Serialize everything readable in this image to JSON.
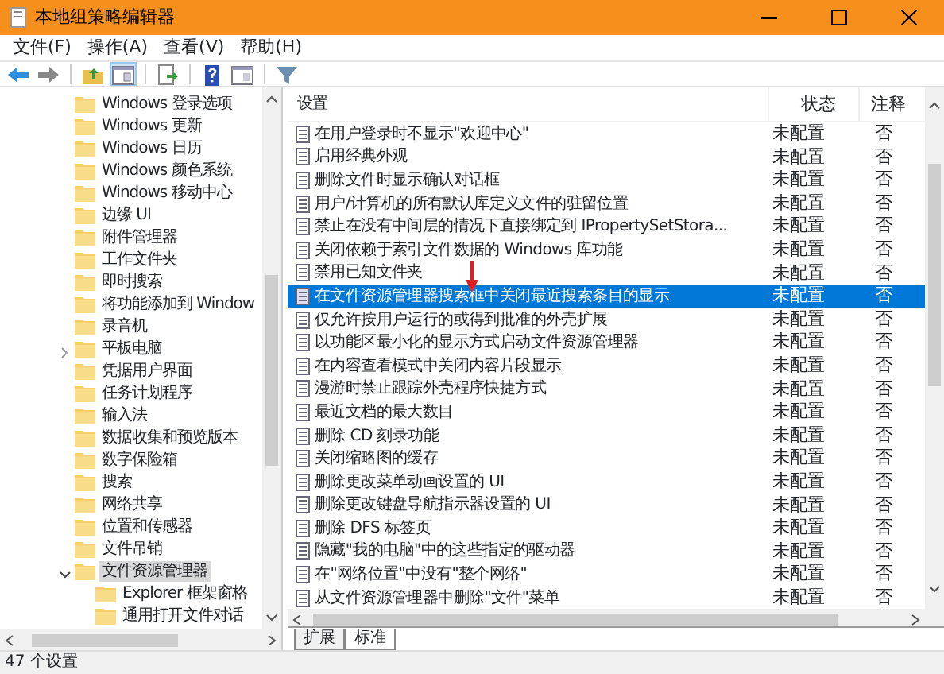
{
  "window": {
    "title": "本地组策略编辑器"
  },
  "menu": [
    "文件(F)",
    "操作(A)",
    "查看(V)",
    "帮助(H)"
  ],
  "toolbar": [
    {
      "kind": "back",
      "disabled": false
    },
    {
      "kind": "forward",
      "disabled": true
    },
    {
      "kind": "sep"
    },
    {
      "kind": "up"
    },
    {
      "kind": "tree",
      "pressed": true
    },
    {
      "kind": "sep"
    },
    {
      "kind": "export"
    },
    {
      "kind": "sep"
    },
    {
      "kind": "help"
    },
    {
      "kind": "view"
    },
    {
      "kind": "sep"
    },
    {
      "kind": "filter"
    }
  ],
  "tree": [
    {
      "label": "Windows 登录选项",
      "selected": false
    },
    {
      "label": "Windows 更新",
      "selected": false
    },
    {
      "label": "Windows 日历",
      "selected": false
    },
    {
      "label": "Windows 颜色系统",
      "selected": false
    },
    {
      "label": "Windows 移动中心",
      "selected": false
    },
    {
      "label": "边缘 UI",
      "selected": false
    },
    {
      "label": "附件管理器",
      "selected": false
    },
    {
      "label": "工作文件夹",
      "selected": false
    },
    {
      "label": "即时搜索",
      "selected": false
    },
    {
      "label": "将功能添加到 Window",
      "selected": false
    },
    {
      "label": "录音机",
      "selected": false
    },
    {
      "label": "平板电脑",
      "selected": false,
      "expanded": false
    },
    {
      "label": "凭据用户界面",
      "selected": false
    },
    {
      "label": "任务计划程序",
      "selected": false
    },
    {
      "label": "输入法",
      "selected": false
    },
    {
      "label": "数据收集和预览版本",
      "selected": false
    },
    {
      "label": "数字保险箱",
      "selected": false
    },
    {
      "label": "搜索",
      "selected": false
    },
    {
      "label": "网络共享",
      "selected": false
    },
    {
      "label": "位置和传感器",
      "selected": false
    },
    {
      "label": "文件吊销",
      "selected": false
    },
    {
      "label": "文件资源管理器",
      "selected": true,
      "expanded": true,
      "children": [
        {
          "label": "Explorer 框架窗格",
          "selected": false
        },
        {
          "label": "通用打开文件对话",
          "selected": false
        }
      ]
    }
  ],
  "table": {
    "columns": [
      "设置",
      "状态",
      "注释"
    ],
    "rows": [
      {
        "setting": "在用户登录时不显示\"欢迎中心\"",
        "state": "未配置",
        "comment": "否",
        "selected": false
      },
      {
        "setting": "启用经典外观",
        "state": "未配置",
        "comment": "否",
        "selected": false
      },
      {
        "setting": "删除文件时显示确认对话框",
        "state": "未配置",
        "comment": "否",
        "selected": false
      },
      {
        "setting": "用户/计算机的所有默认库定义文件的驻留位置",
        "state": "未配置",
        "comment": "否",
        "selected": false
      },
      {
        "setting": "禁止在没有中间层的情况下直接绑定到 IPropertySetStora...",
        "state": "未配置",
        "comment": "否",
        "selected": false
      },
      {
        "setting": "关闭依赖于索引文件数据的 Windows 库功能",
        "state": "未配置",
        "comment": "否",
        "selected": false
      },
      {
        "setting": "禁用已知文件夹",
        "state": "未配置",
        "comment": "否",
        "selected": false
      },
      {
        "setting": "在文件资源管理器搜索框中关闭最近搜索条目的显示",
        "state": "未配置",
        "comment": "否",
        "selected": true
      },
      {
        "setting": "仅允许按用户运行的或得到批准的外壳扩展",
        "state": "未配置",
        "comment": "否",
        "selected": false
      },
      {
        "setting": "以功能区最小化的显示方式启动文件资源管理器",
        "state": "未配置",
        "comment": "否",
        "selected": false
      },
      {
        "setting": "在内容查看模式中关闭内容片段显示",
        "state": "未配置",
        "comment": "否",
        "selected": false
      },
      {
        "setting": "漫游时禁止跟踪外壳程序快捷方式",
        "state": "未配置",
        "comment": "否",
        "selected": false
      },
      {
        "setting": "最近文档的最大数目",
        "state": "未配置",
        "comment": "否",
        "selected": false
      },
      {
        "setting": "删除 CD 刻录功能",
        "state": "未配置",
        "comment": "否",
        "selected": false
      },
      {
        "setting": "关闭缩略图的缓存",
        "state": "未配置",
        "comment": "否",
        "selected": false
      },
      {
        "setting": "删除更改菜单动画设置的 UI",
        "state": "未配置",
        "comment": "否",
        "selected": false
      },
      {
        "setting": "删除更改键盘导航指示器设置的 UI",
        "state": "未配置",
        "comment": "否",
        "selected": false
      },
      {
        "setting": "删除 DFS 标签页",
        "state": "未配置",
        "comment": "否",
        "selected": false
      },
      {
        "setting": "隐藏\"我的电脑\"中的这些指定的驱动器",
        "state": "未配置",
        "comment": "否",
        "selected": false
      },
      {
        "setting": "在\"网络位置\"中没有\"整个网络\"",
        "state": "未配置",
        "comment": "否",
        "selected": false
      },
      {
        "setting": "从文件资源管理器中删除\"文件\"菜单",
        "state": "未配置",
        "comment": "否",
        "selected": false
      }
    ]
  },
  "tabs": [
    {
      "label": "扩展",
      "selected": false
    },
    {
      "label": "标准",
      "selected": true
    }
  ],
  "status_bar": "47 个设置"
}
